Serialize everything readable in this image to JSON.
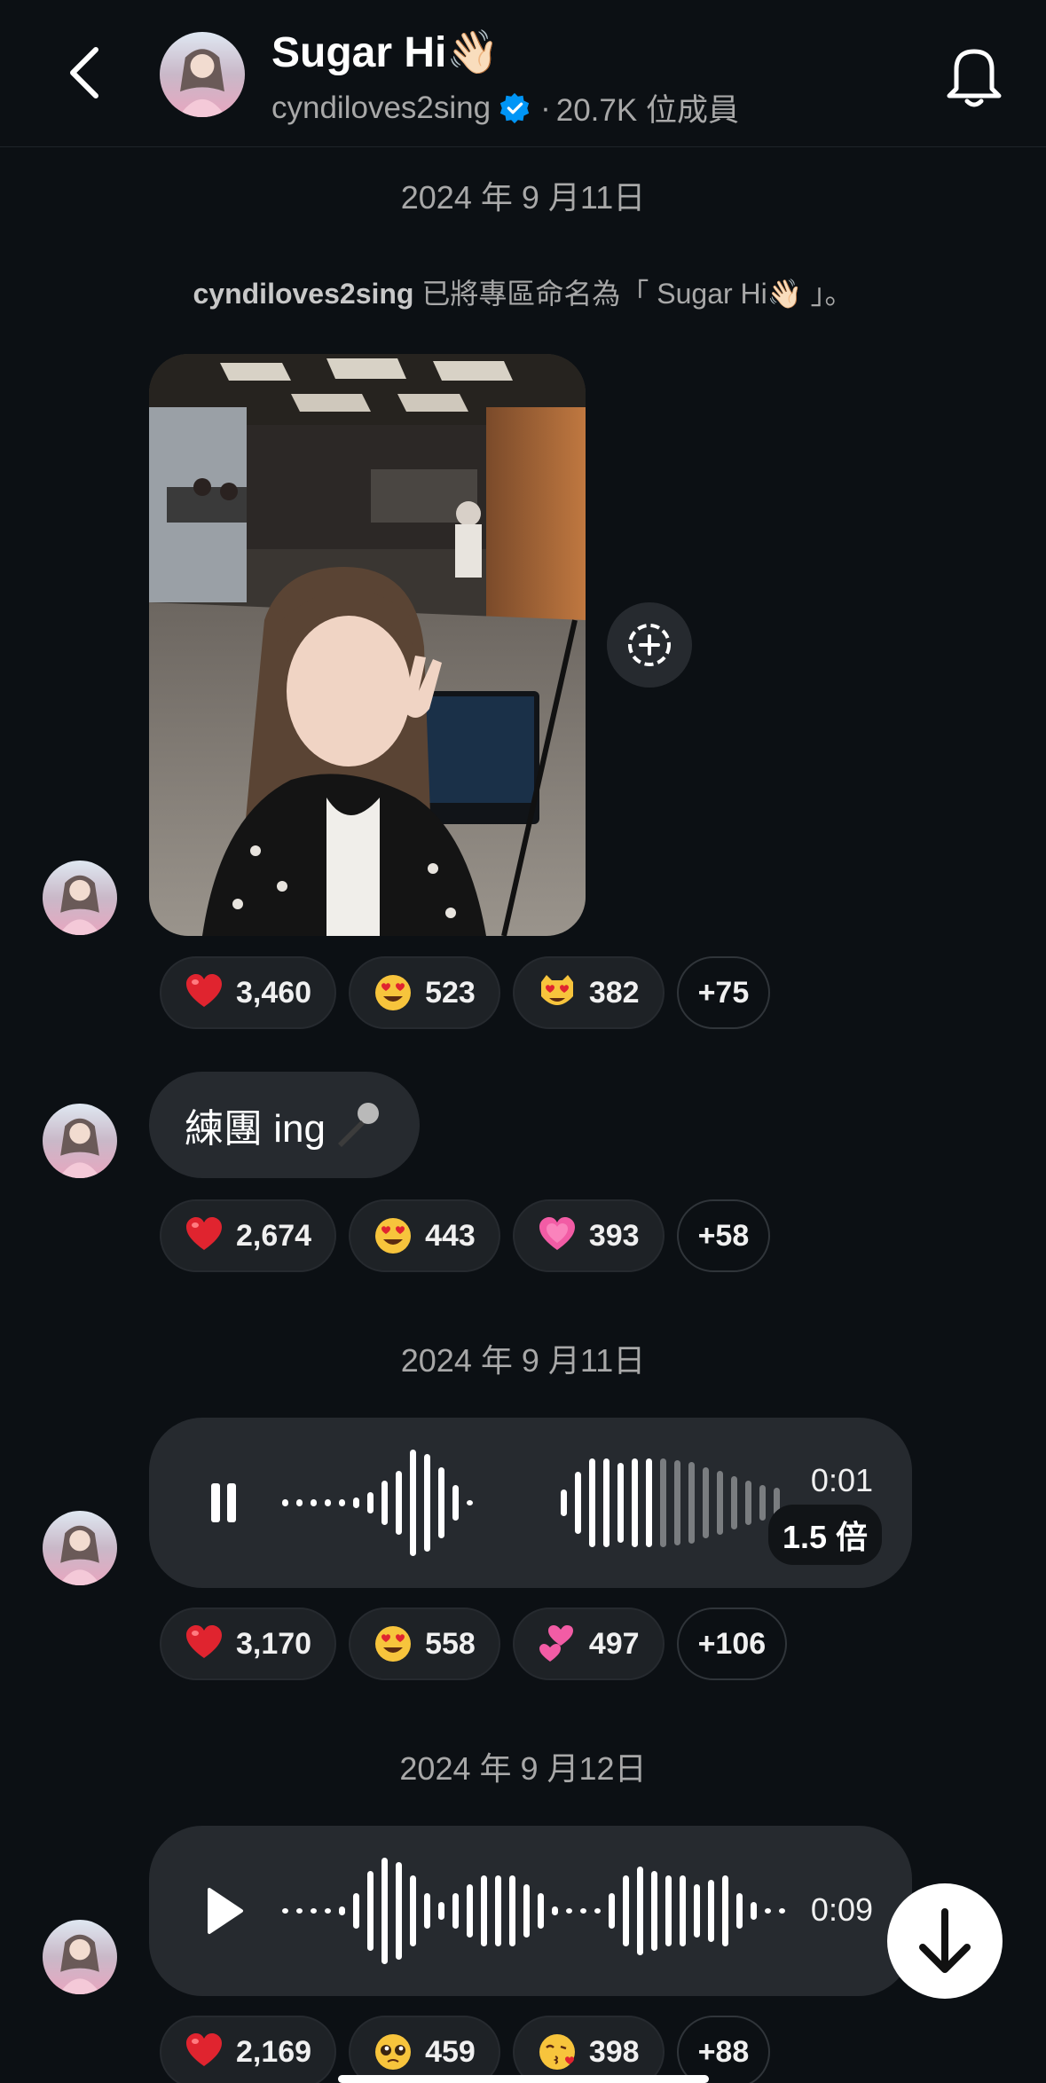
{
  "header": {
    "title": "Sugar Hi👋🏻",
    "username": "cyndiloves2sing",
    "separator": "·",
    "members": "20.7K 位成員",
    "back_icon": "chevron-left-icon",
    "bell_icon": "bell-icon"
  },
  "dates": {
    "first": "2024 年 9 月11日",
    "second": "2024 年 9 月11日",
    "third": "2024 年 9 月12日"
  },
  "system_message": {
    "user": "cyndiloves2sing",
    "text": " 已將專區命名為「 Sugar Hi👋🏻 」。"
  },
  "messages": {
    "photo": {
      "reactions": [
        {
          "emoji": "heart",
          "count": "3,460"
        },
        {
          "emoji": "heart-eyes",
          "count": "523"
        },
        {
          "emoji": "cat-heart-eyes",
          "count": "382"
        }
      ],
      "more": "+75"
    },
    "text": {
      "body": "練團 ing",
      "reactions": [
        {
          "emoji": "heart",
          "count": "2,674"
        },
        {
          "emoji": "heart-eyes",
          "count": "443"
        },
        {
          "emoji": "pink-heart",
          "count": "393"
        }
      ],
      "more": "+58"
    },
    "voice1": {
      "state": "playing",
      "time": "0:01",
      "speed": "1.5 倍",
      "reactions": [
        {
          "emoji": "heart",
          "count": "3,170"
        },
        {
          "emoji": "heart-eyes",
          "count": "558"
        },
        {
          "emoji": "two-hearts",
          "count": "497"
        }
      ],
      "more": "+106"
    },
    "voice2": {
      "state": "paused",
      "time": "0:09",
      "reactions": [
        {
          "emoji": "heart",
          "count": "2,169"
        },
        {
          "emoji": "pleading-face",
          "count": "459"
        },
        {
          "emoji": "kissing-face",
          "count": "398"
        }
      ],
      "more": "+88"
    }
  },
  "colors": {
    "background": "#0c1014",
    "bubble": "#262a2f",
    "secondary_text": "#a8a8a8",
    "verified": "#0095f6",
    "heart": "#e0242f",
    "emoji_yellow": "#f7c43c"
  }
}
